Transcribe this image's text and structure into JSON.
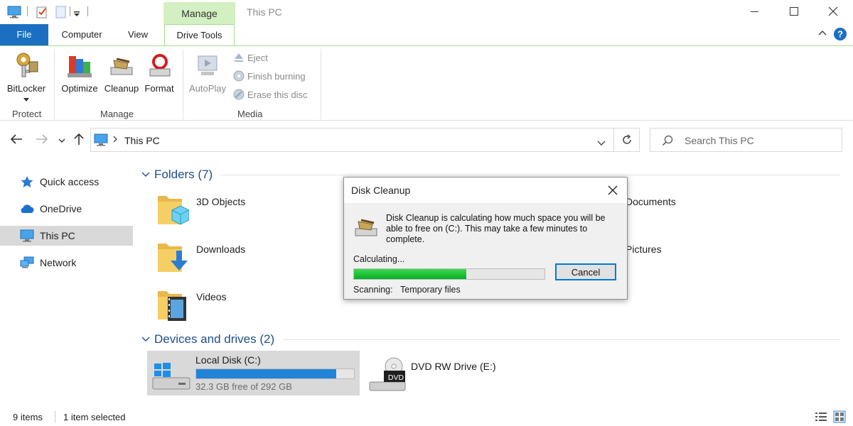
{
  "window": {
    "title": "This PC",
    "context_tab": "Manage"
  },
  "ribbon": {
    "tabs": [
      "File",
      "Computer",
      "View",
      "Drive Tools"
    ],
    "buttons": {
      "bitlocker": "BitLocker",
      "optimize": "Optimize",
      "cleanup": "Cleanup",
      "format": "Format",
      "autoplay": "AutoPlay",
      "eject": "Eject",
      "finish_burning": "Finish burning",
      "erase_disc": "Erase this disc"
    },
    "groups": {
      "protect": "Protect",
      "manage": "Manage",
      "media": "Media"
    }
  },
  "navbar": {
    "address": "This PC",
    "search_placeholder": "Search This PC"
  },
  "sidebar": {
    "items": [
      {
        "label": "Quick access",
        "icon": "star-icon"
      },
      {
        "label": "OneDrive",
        "icon": "cloud-icon"
      },
      {
        "label": "This PC",
        "icon": "computer-icon",
        "selected": true
      },
      {
        "label": "Network",
        "icon": "network-icon"
      }
    ]
  },
  "content": {
    "folders_header": "Folders (7)",
    "folders": [
      {
        "label": "3D Objects"
      },
      {
        "label": "Downloads"
      },
      {
        "label": "Videos"
      },
      {
        "label": "Documents"
      },
      {
        "label": "Pictures"
      }
    ],
    "devices_header": "Devices and drives (2)",
    "drives": [
      {
        "label": "Local Disk (C:)",
        "free": "32.3 GB free of 292 GB",
        "used_fraction": 0.889
      },
      {
        "label": "DVD RW Drive (E:)",
        "badge": "DVD"
      }
    ]
  },
  "dialog": {
    "title": "Disk Cleanup",
    "message": "Disk Cleanup is calculating how much space you will be able to free on  (C:). This may take a few minutes to complete.",
    "calculating": "Calculating...",
    "progress_fraction": 0.59,
    "cancel": "Cancel",
    "scanning_label": "Scanning:",
    "scanning_value": "Temporary files"
  },
  "status": {
    "item_count": "9 items",
    "selected": "1 item selected"
  },
  "colors": {
    "accent": "#1a6fc2",
    "context_tab": "#d2f0c1",
    "progress_green": "#06b025",
    "drive_bar": "#2383d9",
    "header_blue": "#1e4e8c"
  }
}
